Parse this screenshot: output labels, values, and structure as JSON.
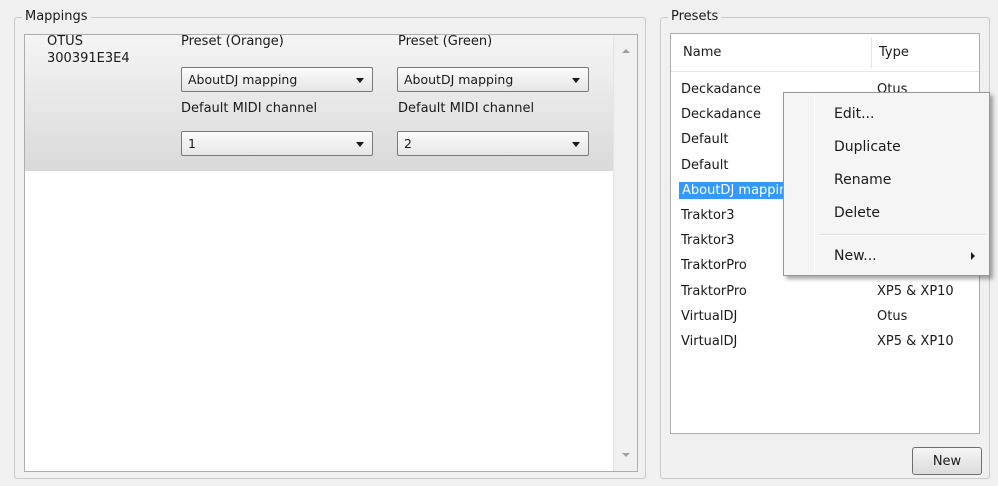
{
  "mappings": {
    "title": "Mappings",
    "device": {
      "name": "OTUS",
      "serial": "300391E3E4",
      "preset_orange_label": "Preset (Orange)",
      "preset_orange_value": "AboutDJ mapping",
      "preset_green_label": "Preset (Green)",
      "preset_green_value": "AboutDJ mapping",
      "midi_orange_label": "Default MIDI channel",
      "midi_orange_value": "1",
      "midi_green_label": "Default MIDI channel",
      "midi_green_value": "2"
    }
  },
  "presets": {
    "title": "Presets",
    "columns": {
      "name": "Name",
      "type": "Type"
    },
    "rows": [
      {
        "name": "Deckadance",
        "type": "Otus"
      },
      {
        "name": "Deckadance",
        "type": ""
      },
      {
        "name": "Default",
        "type": ""
      },
      {
        "name": "Default",
        "type": ""
      },
      {
        "name": "AboutDJ mapping",
        "type": ""
      },
      {
        "name": "Traktor3",
        "type": ""
      },
      {
        "name": "Traktor3",
        "type": ""
      },
      {
        "name": "TraktorPro",
        "type": ""
      },
      {
        "name": "TraktorPro",
        "type": "XP5 & XP10"
      },
      {
        "name": "VirtualDJ",
        "type": "Otus"
      },
      {
        "name": "VirtualDJ",
        "type": "XP5 & XP10"
      }
    ],
    "selected_index": 4,
    "new_button_label": "New"
  },
  "context_menu": {
    "items": [
      {
        "label": "Edit..."
      },
      {
        "label": "Duplicate"
      },
      {
        "label": "Rename"
      },
      {
        "label": "Delete"
      }
    ],
    "submenu_label": "New..."
  },
  "icons": {
    "dropdown": "chevron-down-icon",
    "submenu": "chevron-right-icon",
    "scroll_up": "scroll-up-icon",
    "scroll_down": "scroll-down-icon"
  },
  "colors": {
    "selection": "#3399ff",
    "panel_bg": "#f0f0f0"
  }
}
